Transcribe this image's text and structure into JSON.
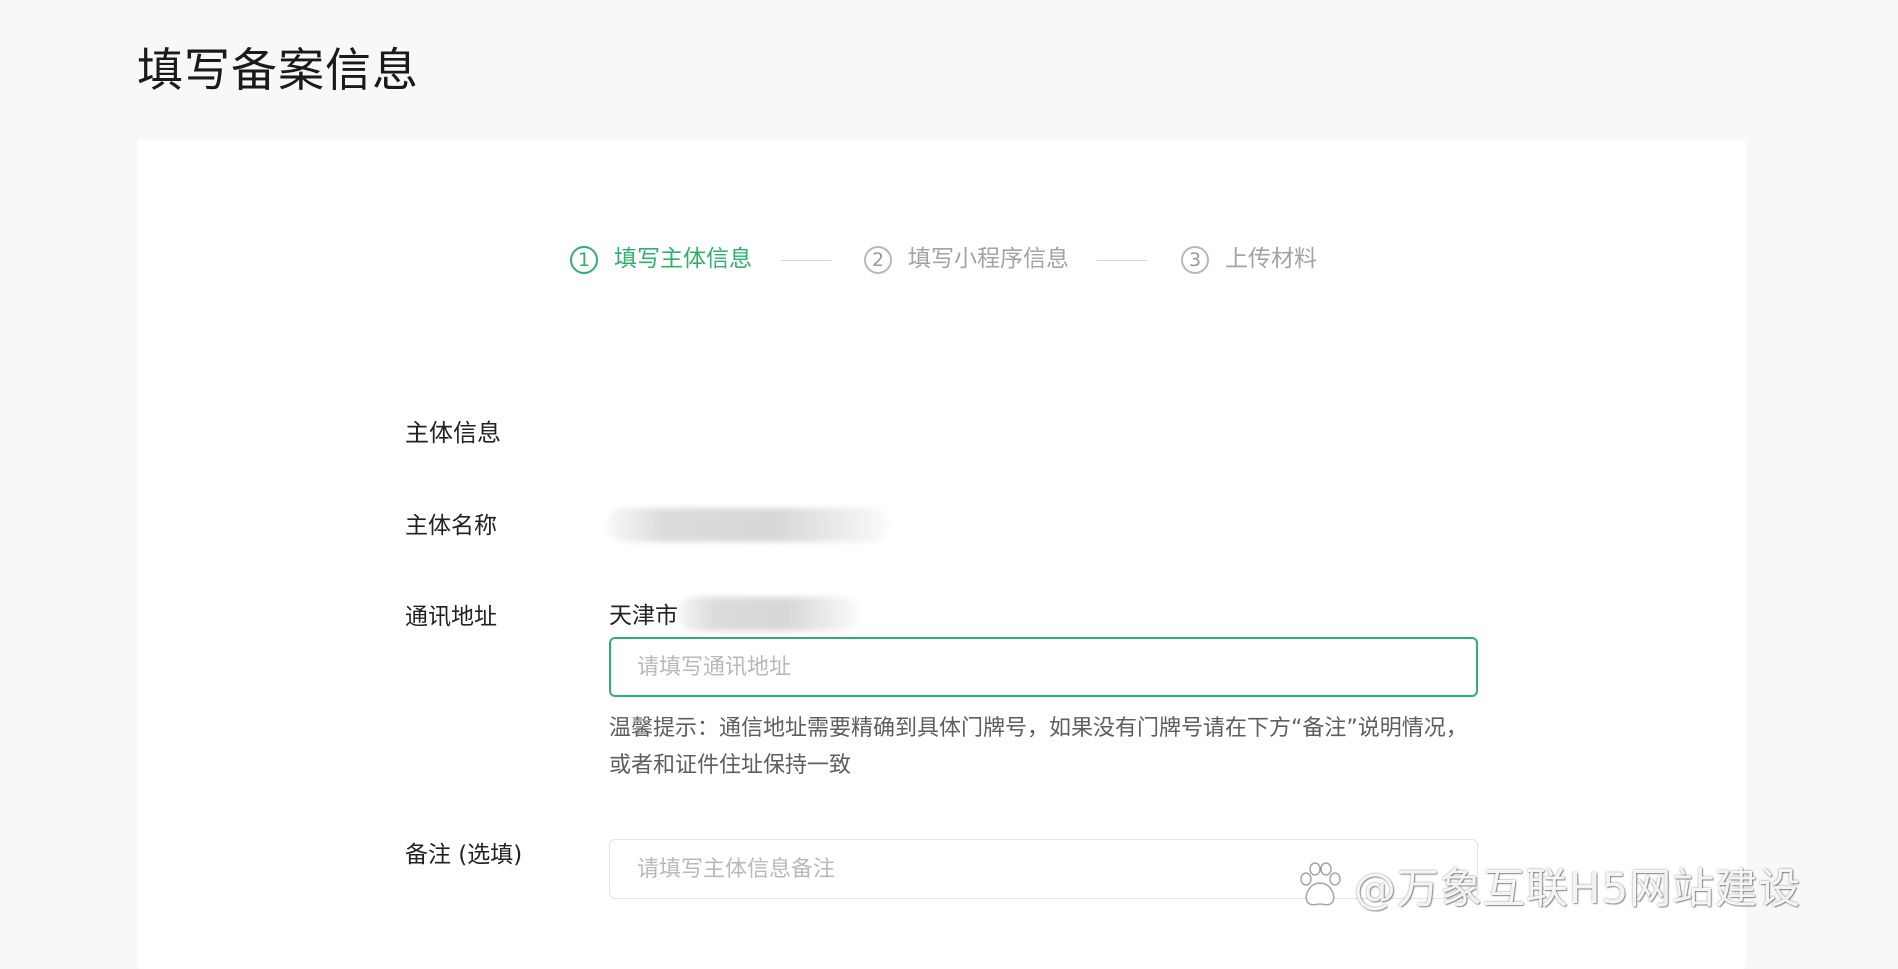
{
  "page": {
    "title": "填写备案信息"
  },
  "steps": [
    {
      "number": "1",
      "label": "填写主体信息",
      "state": "active"
    },
    {
      "number": "2",
      "label": "填写小程序信息",
      "state": "pending"
    },
    {
      "number": "3",
      "label": "上传材料",
      "state": "pending"
    }
  ],
  "form": {
    "section_title": "主体信息",
    "subject_name": {
      "label": "主体名称"
    },
    "address": {
      "label": "通讯地址",
      "region_prefix": "天津市",
      "placeholder": "请填写通讯地址",
      "hint": "温馨提示：通信地址需要精确到具体门牌号，如果没有门牌号请在下方“备注”说明情况，或者和证件住址保持一致"
    },
    "remark": {
      "label": "备注 (选填)",
      "placeholder": "请填写主体信息备注"
    }
  },
  "watermark": {
    "text": "@万象互联H5网站建设",
    "icon": "baidu-paw-icon"
  },
  "colors": {
    "accent": "#2fb06f",
    "background": "#f7f8fa",
    "card": "#ffffff",
    "muted": "#a3a3a3"
  }
}
